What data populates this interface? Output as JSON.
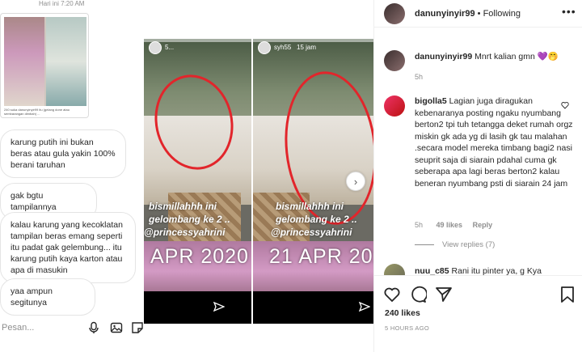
{
  "chat": {
    "time": "Hari ini 7:20 AM",
    "shared_caption": "240 suka danunyinyir99 itu (gelang done atau sembarangan dimbah) ...",
    "messages": [
      "karung putih ini bukan beras atau gula yakin 100% berani taruhan",
      "gak bgtu tampilannya",
      "kalau karung  yang kecoklatan tampilan beras emang seperti itu padat gak gelembung... itu karung putih kaya karton atau apa di masukin",
      "yaa ampun segitunya"
    ],
    "input_placeholder": "Pesan...",
    "icons": [
      "mic-icon",
      "image-icon",
      "sticker-icon"
    ]
  },
  "stories": {
    "left": {
      "user": "5...",
      "caption_line1": "bismillahhh ini",
      "caption_line2": "gelombang ke 2 ..",
      "caption_line3": "@princessyahrini",
      "date": "APR 2020"
    },
    "right": {
      "user": "syh55",
      "time": "15 jam",
      "caption_line1": "bismillahhh ini",
      "caption_line2": "gelombang ke 2 ..",
      "caption_line3": "@princessyahrini",
      "date": "21 APR 2020"
    }
  },
  "post": {
    "username": "danunyinyir99",
    "separator": "•",
    "follow_status": "Following",
    "caption": {
      "user": "danunyinyir99",
      "text": "Mnrt kalian gmn 💜🤭",
      "time": "5h"
    },
    "comments": [
      {
        "user": "bigolla5",
        "text": "Lagian juga diragukan kebenaranya posting ngaku nyumbang berton2 tpi tuh tetangga deket rumah orgz miskin gk ada yg di lasih gk tau malahan .secara model mereka timbang bagi2 nasi seuprit saja di siarain pdahal cuma gk seberapa apa lagi beras berton2 kalau beneran nyumbang psti di siarain 24 jam",
        "time": "5h",
        "likes": "49 likes",
        "reply": "Reply",
        "view_replies": "View replies (7)"
      },
      {
        "user": "nuu_c85",
        "text": "Rani itu pinter ya, g Kya"
      }
    ],
    "likes": "240 likes",
    "time_ago": "5 HOURS AGO"
  }
}
